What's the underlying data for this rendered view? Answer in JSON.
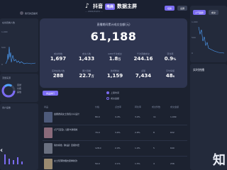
{
  "header": {
    "app_name": "抖音",
    "tag": "电商",
    "title": "数据主屏",
    "subline": "... 2022/01/01 ...",
    "btn_left": "切换",
    "btn_right": "全屏"
  },
  "user": {
    "name": "我们的直播间"
  },
  "left_panel": {
    "title": "在线观看人数",
    "chart_axis": [
      "1,000",
      "500",
      "0"
    ]
  },
  "left_lower": {
    "title": "流量来源",
    "items": [
      "自然",
      "付费",
      "其他"
    ]
  },
  "left_bottom": {
    "title": "用户画像"
  },
  "hero": {
    "caption": "直播期间累计成交金额(元)",
    "value": "61,188",
    "metrics": [
      {
        "label": "成交件数",
        "value": "1,697"
      },
      {
        "label": "成交人数",
        "value": "1,433"
      },
      {
        "label": "GPM/千次成交",
        "value": "1.8",
        "unit": "万"
      },
      {
        "label": "千次观看成交",
        "value": "244.16"
      },
      {
        "label": "转化率",
        "value": "0.9",
        "unit": "%"
      },
      {
        "label": "实时在线人数",
        "value": "288"
      },
      {
        "label": "累计观看",
        "value": "22.7",
        "unit": "万"
      },
      {
        "label": "新增粉丝",
        "value": "1,159"
      },
      {
        "label": "点赞",
        "value": "7,434"
      },
      {
        "label": "平均停留",
        "value": "48",
        "unit": "s"
      }
    ]
  },
  "table": {
    "tab_label": "商品排行",
    "radio_a": "上架时间",
    "radio_b": "成交金额",
    "columns": [
      "商品",
      "价格",
      "点击率",
      "转化率",
      "成交件数",
      "成交金额"
    ],
    "rows": [
      {
        "title": "金属质感女士钱包小众设计",
        "price": "89.0",
        "ctr": "4.4%",
        "cvr": "3.0%",
        "qty": "11",
        "amount": "1,009"
      },
      {
        "title": "[元气宝宝] 儿童卡通纯棉",
        "price": "79.0",
        "ctr": "3.6%",
        "cvr": "2.8%",
        "qty": "8",
        "amount": "632"
      },
      {
        "title": "简约纯色【新品】百搭外套",
        "price": "128.0",
        "ctr": "2.9%",
        "cvr": "1.9%",
        "qty": "5",
        "amount": "640"
      },
      {
        "title": "女士轻薄防晒衣夏季新款",
        "price": "59.0",
        "ctr": "2.1%",
        "cvr": "1.5%",
        "qty": "4",
        "amount": "236"
      }
    ]
  },
  "right_panel": {
    "tab_a": "人气趋势",
    "tab_b": "成交",
    "axis": [
      "1,000",
      "500",
      "0"
    ]
  },
  "right_lower": {
    "title": "实时热播"
  },
  "colors": {
    "accent": "#7b6cf2",
    "line": "#4fa3ff",
    "bar": "#7b6cf2",
    "bg": "#1c2230"
  }
}
